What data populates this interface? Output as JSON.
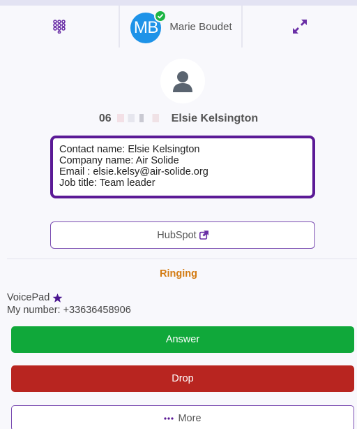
{
  "header": {
    "dialpad_icon": "dialpad-icon",
    "user": {
      "initials": "MB",
      "name": "Marie Boudet",
      "status_color": "#1db544",
      "avatar_color": "#1e93e8"
    },
    "expand_icon": "expand-arrows-icon"
  },
  "contact": {
    "photo_icon": "person-icon",
    "number_prefix": "06",
    "name": "Elsie Kelsington",
    "details": [
      "Contact name: Elsie Kelsington",
      "Company name: Air Solide",
      "Email : elsie.kelsy@air-solide.org",
      "Job title: Team leader"
    ],
    "crm_button": "HubSpot",
    "crm_icon": "external-link-icon"
  },
  "call": {
    "status": "Ringing",
    "line_name": "VoicePad",
    "line_icon": "star-icon",
    "my_number": "My number: +33636458906"
  },
  "actions": {
    "answer": "Answer",
    "drop": "Drop",
    "more": "More"
  },
  "colors": {
    "accent": "#5b1a96",
    "answer": "#10a83a",
    "drop": "#b82520",
    "ringing": "#d37b12"
  }
}
